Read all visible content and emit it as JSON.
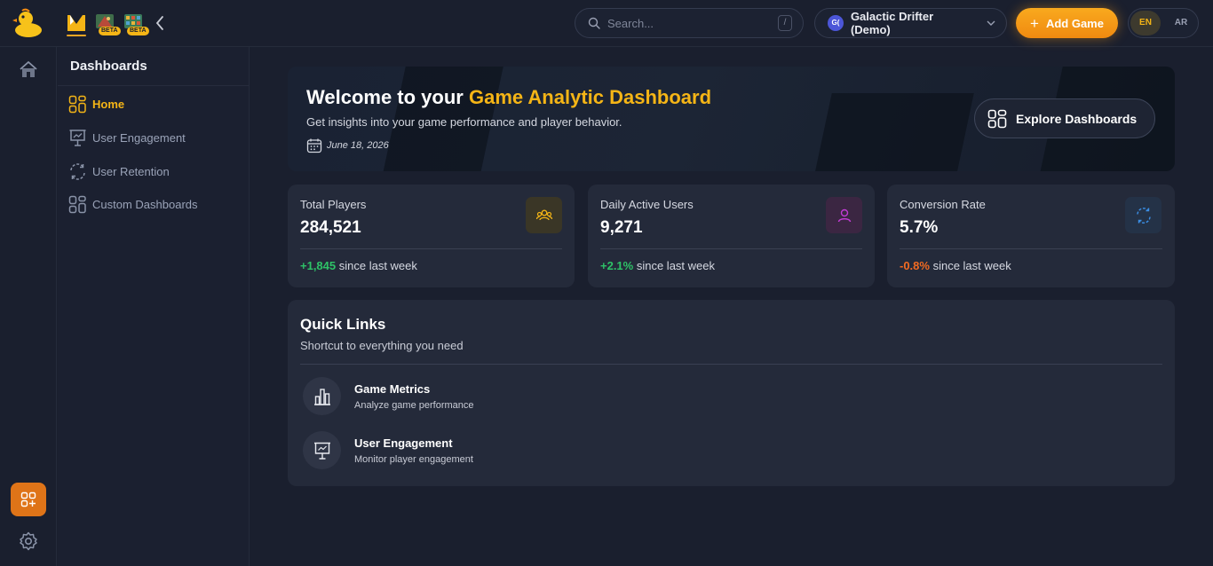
{
  "header": {
    "search_placeholder": "Search...",
    "search_shortcut": "/",
    "game": {
      "avatar": "G(",
      "name": "Galactic Drifter (Demo)"
    },
    "add_game_label": "Add Game",
    "beta_badge_1": "BETA",
    "beta_badge_2": "BETA",
    "languages": [
      {
        "code": "EN",
        "active": true
      },
      {
        "code": "AR",
        "active": false
      }
    ]
  },
  "sidebar": {
    "title": "Dashboards",
    "items": [
      {
        "label": "Home",
        "icon": "grid-icon",
        "active": true
      },
      {
        "label": "User Engagement",
        "icon": "presentation-icon",
        "active": false
      },
      {
        "label": "User Retention",
        "icon": "refresh-icon",
        "active": false
      },
      {
        "label": "Custom Dashboards",
        "icon": "grid-icon",
        "active": false
      }
    ]
  },
  "hero": {
    "title_prefix": "Welcome to your ",
    "title_accent": "Game Analytic Dashboard",
    "subtitle": "Get insights into your game performance and player behavior.",
    "date": "June 18, 2026",
    "explore_label": "Explore Dashboards"
  },
  "stats": [
    {
      "label": "Total Players",
      "value": "284,521",
      "change": "+1,845",
      "change_suffix": " since last week",
      "trend": "up",
      "icon": "users-icon",
      "icon_color": "#f5b516"
    },
    {
      "label": "Daily Active Users",
      "value": "9,271",
      "change": "+2.1%",
      "change_suffix": " since last week",
      "trend": "up",
      "icon": "user-icon",
      "icon_color": "#c23bd4"
    },
    {
      "label": "Conversion Rate",
      "value": "5.7%",
      "change": "-0.8%",
      "change_suffix": " since last week",
      "trend": "down",
      "icon": "refresh-icon",
      "icon_color": "#3b8fe6"
    }
  ],
  "quick_links": {
    "title": "Quick Links",
    "subtitle": "Shortcut to everything you need",
    "items": [
      {
        "title": "Game Metrics",
        "desc": "Analyze game performance",
        "icon": "bar-chart-icon"
      },
      {
        "title": "User Engagement",
        "desc": "Monitor player engagement",
        "icon": "presentation-icon"
      }
    ]
  },
  "colors": {
    "accent": "#f5b516",
    "up": "#2ec267",
    "down": "#f26b22",
    "background": "#1a1f2e",
    "card": "#242a3a"
  }
}
